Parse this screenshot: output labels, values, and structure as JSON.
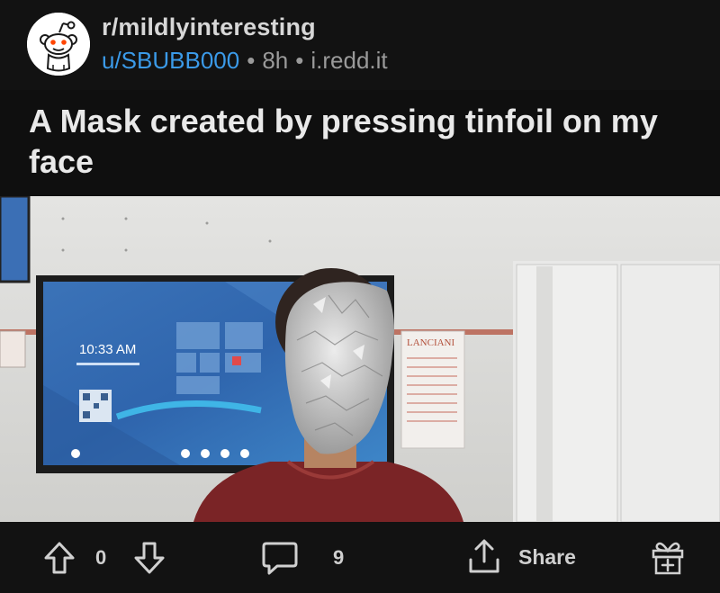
{
  "post": {
    "subreddit": "r/mildlyinteresting",
    "author": "u/SBUBB000",
    "age": "8h",
    "domain": "i.redd.it",
    "title": "A Mask created by pressing tinfoil on my face"
  },
  "photo": {
    "screen_time": "10:33 AM",
    "poster_label": "LANCIANI"
  },
  "actions": {
    "vote_count": "0",
    "comment_count": "9",
    "share_label": "Share"
  },
  "icons": [
    "reddit-snoo-icon",
    "upvote-arrow-icon",
    "downvote-arrow-icon",
    "comment-bubble-icon",
    "share-icon",
    "award-gift-icon"
  ],
  "colors": {
    "background": "#121212",
    "username": "#3b9ae8",
    "text": "#e9e9e9",
    "muted": "#9a9a9a"
  }
}
